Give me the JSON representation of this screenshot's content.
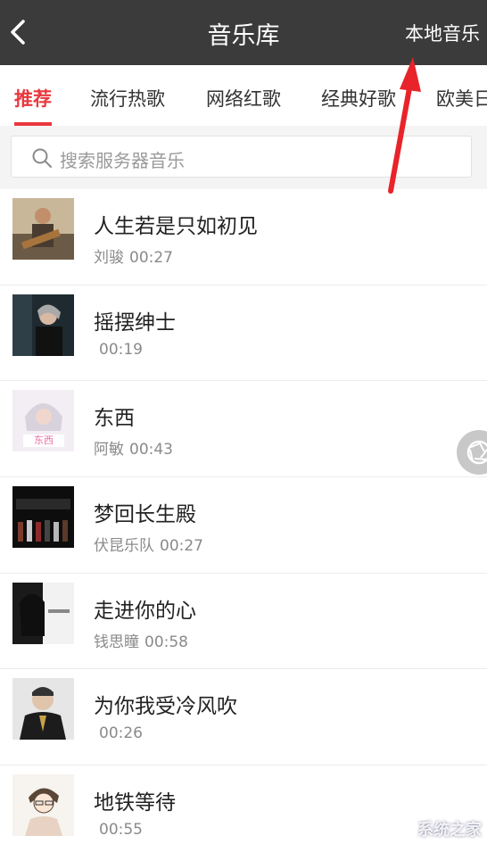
{
  "header": {
    "title": "音乐库",
    "right_action": "本地音乐"
  },
  "tabs": [
    {
      "label": "推荐",
      "active": true
    },
    {
      "label": "流行热歌",
      "active": false
    },
    {
      "label": "网络红歌",
      "active": false
    },
    {
      "label": "经典好歌",
      "active": false
    },
    {
      "label": "欧美日",
      "active": false
    }
  ],
  "search": {
    "placeholder": "搜索服务器音乐"
  },
  "songs": [
    {
      "title": "人生若是只如初见",
      "artist": "刘骏",
      "duration": "00:27"
    },
    {
      "title": "摇摆绅士",
      "artist": "",
      "duration": "00:19"
    },
    {
      "title": "东西",
      "artist": "阿敏",
      "duration": "00:43"
    },
    {
      "title": "梦回长生殿",
      "artist": "伏昆乐队",
      "duration": "00:27"
    },
    {
      "title": "走进你的心",
      "artist": "钱思瞳",
      "duration": "00:58"
    },
    {
      "title": "为你我受冷风吹",
      "artist": "",
      "duration": "00:26"
    },
    {
      "title": "地铁等待",
      "artist": "",
      "duration": "00:55"
    }
  ],
  "colors": {
    "accent": "#e8383d",
    "topbar": "#3b3b3b",
    "annotation_arrow": "#e8232a"
  },
  "watermark": "系统之家"
}
